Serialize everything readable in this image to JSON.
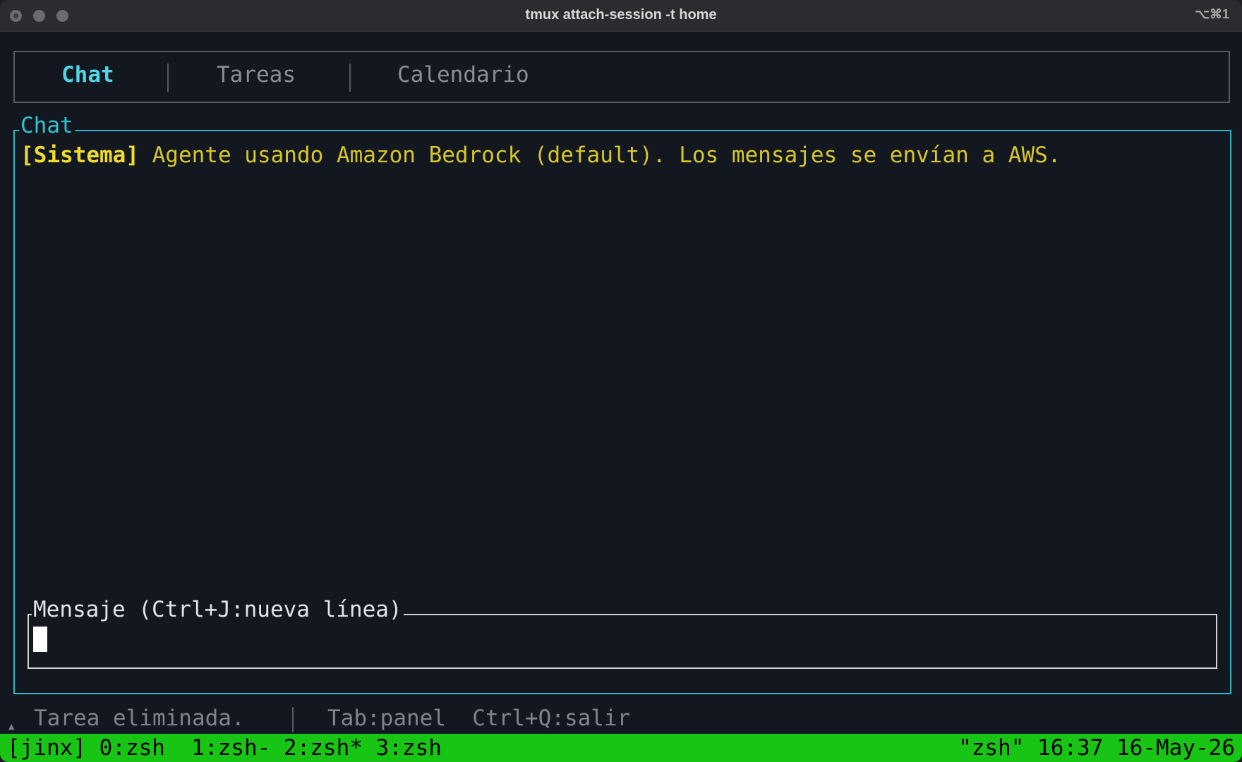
{
  "window": {
    "title": "tmux attach-session -t home",
    "shortcut": "⌥⌘1"
  },
  "tabs": [
    {
      "label": "Chat",
      "active": true
    },
    {
      "label": "Tareas",
      "active": false
    },
    {
      "label": "Calendario",
      "active": false
    }
  ],
  "chat": {
    "title": "Chat",
    "messages": [
      {
        "sender": "[Sistema]",
        "text": " Agente usando Amazon Bedrock (default). Los mensajes se envían a AWS."
      }
    ]
  },
  "input": {
    "title": "Mensaje (Ctrl+J:nueva línea)",
    "value": ""
  },
  "status": {
    "message": "Tarea eliminada.",
    "keys": "Tab:panel  Ctrl+Q:salir"
  },
  "tmux": {
    "left": "[jinx] 0:zsh  1:zsh- 2:zsh* 3:zsh",
    "right": "\"zsh\" 16:37 16-May-26"
  },
  "colors": {
    "accent": "#2fb6c4",
    "system_message": "#d8c62a",
    "tmux_bar": "#18c414"
  }
}
